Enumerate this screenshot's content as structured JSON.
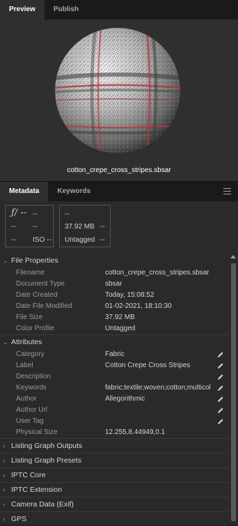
{
  "tabs_top": [
    "Preview",
    "Publish"
  ],
  "preview": {
    "filename": "cotton_crepe_cross_stripes.sbsar"
  },
  "tabs_bottom": [
    "Metadata",
    "Keywords"
  ],
  "menu_icon": "hamburger-menu-icon",
  "camera_card": {
    "fstop": "ƒ/ --",
    "shutter": "--",
    "r2a": "--",
    "r2b": "--",
    "r3a": "--",
    "iso": "ISO --"
  },
  "file_card": {
    "r1": "--",
    "size": "37.92 MB",
    "size_dash": "--",
    "color": "Untagged",
    "color_dash": "--"
  },
  "file_properties": {
    "title": "File Properties",
    "rows": [
      {
        "label": "Filename",
        "value": "cotton_crepe_cross_stripes.sbsar"
      },
      {
        "label": "Document Type",
        "value": "sbsar"
      },
      {
        "label": "Date Created",
        "value": "Today, 15:08:52"
      },
      {
        "label": "Date File Modified",
        "value": "01-02-2021, 18:10:30"
      },
      {
        "label": "File Size",
        "value": "37.92 MB"
      },
      {
        "label": "Color Profile",
        "value": "Untagged"
      }
    ]
  },
  "attributes": {
    "title": "Attributes",
    "rows": [
      {
        "label": "Category",
        "value": "Fabric",
        "editable": true
      },
      {
        "label": "Label",
        "value": "Cotton Crepe Cross Stripes",
        "editable": true
      },
      {
        "label": "Description",
        "value": "",
        "editable": true
      },
      {
        "label": "Keywords",
        "value": "fabric;textile;woven;cotton;multicol",
        "editable": true
      },
      {
        "label": "Author",
        "value": "Allegorithmic",
        "editable": true
      },
      {
        "label": "Author Url",
        "value": "",
        "editable": true
      },
      {
        "label": "User Tag",
        "value": "",
        "editable": true
      },
      {
        "label": "Physical Size",
        "value": "12.255,8.44949,0.1",
        "editable": false
      }
    ]
  },
  "collapsed_sections": [
    "Listing Graph Outputs",
    "Listing Graph Presets",
    "IPTC Core",
    "IPTC Extension",
    "Camera Data (Exif)",
    "GPS"
  ],
  "colors": {
    "accent_red": "#b8323a",
    "panel": "#2a2a2a"
  }
}
